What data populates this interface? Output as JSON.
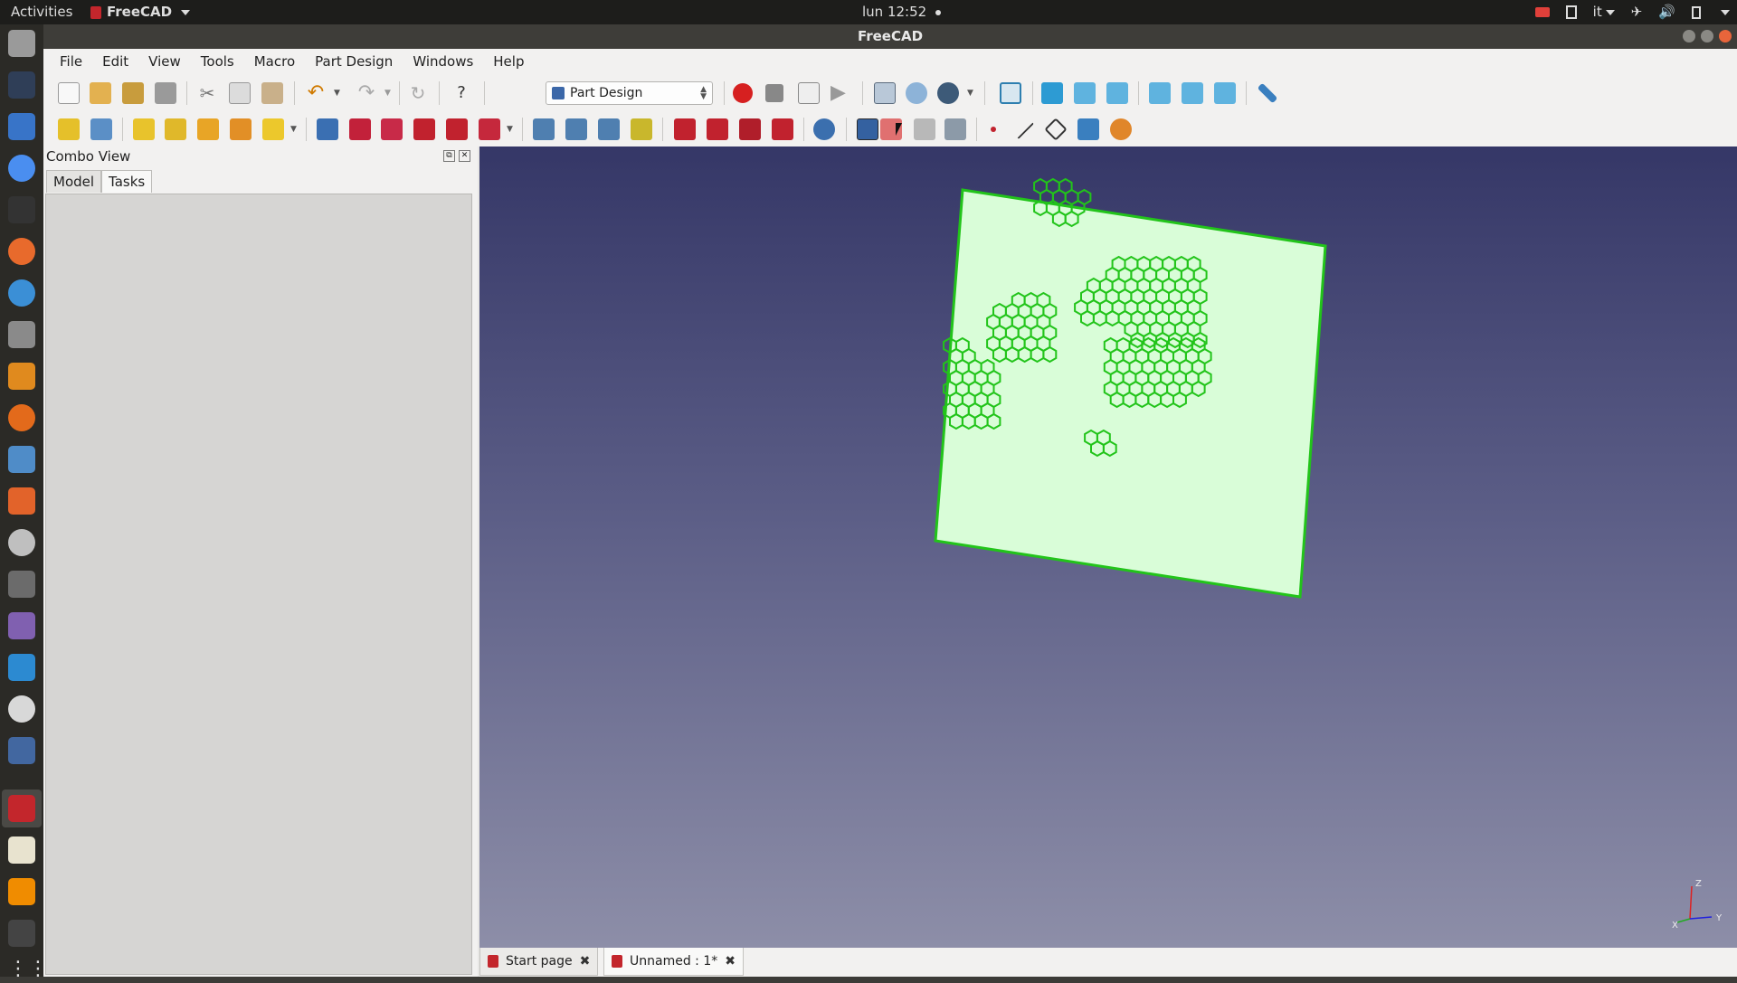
{
  "topbar": {
    "activities": "Activities",
    "app_name": "FreeCAD",
    "clock": "lun 12:52",
    "keyboard_layout": "it"
  },
  "window": {
    "title": "FreeCAD"
  },
  "menu": [
    "File",
    "Edit",
    "View",
    "Tools",
    "Macro",
    "Part Design",
    "Windows",
    "Help"
  ],
  "toolbar": {
    "workbench_selected": "Part Design",
    "icons1": [
      "new-file-icon",
      "open-file-icon",
      "save-icon",
      "print-icon",
      "cut-icon",
      "copy-icon",
      "paste-icon",
      "undo-icon",
      "redo-icon",
      "refresh-icon",
      "whats-this-icon",
      "record-macro-icon",
      "stop-macro-icon",
      "edit-macro-icon",
      "run-macro-icon",
      "fit-all-icon",
      "fit-selection-icon",
      "draw-style-icon",
      "isometric-view-icon",
      "front-view-icon",
      "top-view-icon",
      "right-view-icon",
      "rear-view-icon",
      "bottom-view-icon",
      "left-view-icon",
      "measure-distance-icon"
    ],
    "icons2": [
      "create-body-icon",
      "create-sketch-icon",
      "pad-icon",
      "revolution-icon",
      "additive-loft-icon",
      "additive-pipe-icon",
      "additive-primitive-icon",
      "pocket-icon",
      "hole-icon",
      "groove-icon",
      "subtractive-loft-icon",
      "subtractive-pipe-icon",
      "subtractive-primitive-icon",
      "mirrored-icon",
      "linear-pattern-icon",
      "polar-pattern-icon",
      "multi-transform-icon",
      "fillet-icon",
      "chamfer-icon",
      "draft-icon",
      "thickness-icon",
      "boolean-icon",
      "shape-binder-icon",
      "clone-icon",
      "migrate-icon",
      "sprocket-icon",
      "datum-point-icon",
      "datum-line-icon",
      "datum-plane-icon",
      "local-cs-icon",
      "involute-gear-icon"
    ]
  },
  "combo_view": {
    "title": "Combo View",
    "tabs": [
      "Model",
      "Tasks"
    ],
    "selected_tab": "Tasks"
  },
  "doc_tabs": [
    {
      "label": "Start page"
    },
    {
      "label": "Unnamed : 1*"
    }
  ],
  "colors": {
    "part_fill": "#d9fdd8",
    "part_edges": "#22c41a",
    "view_bg_top": "#353767",
    "view_bg_bottom": "#8d8ea8"
  },
  "axis_labels": {
    "x": "X",
    "y": "Y",
    "z": "Z"
  }
}
